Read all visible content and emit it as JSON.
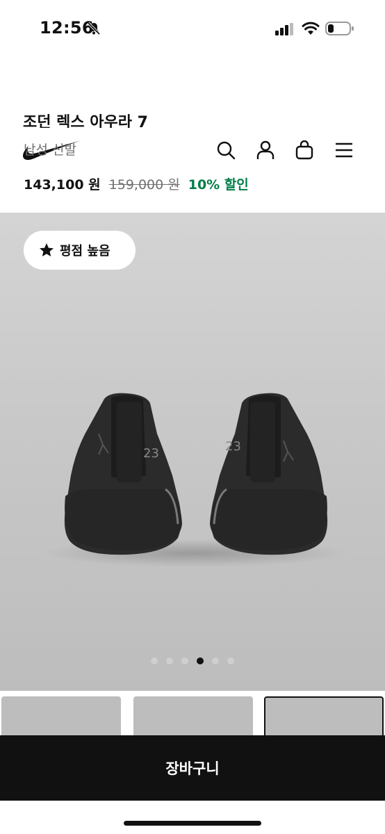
{
  "status_bar": {
    "time": "12:56"
  },
  "product": {
    "name": "조던 렉스 아우라 7",
    "category": "남성 신발",
    "price_current": "143,100 원",
    "price_original": "159,000 원",
    "discount": "10% 할인"
  },
  "badge": {
    "label": "평점 높음",
    "icon": "star-icon"
  },
  "carousel": {
    "total": 6,
    "active": 3
  },
  "cart": {
    "label": "장바구니"
  },
  "colors": {
    "discount": "#007d48",
    "cart_bg": "#111111"
  }
}
